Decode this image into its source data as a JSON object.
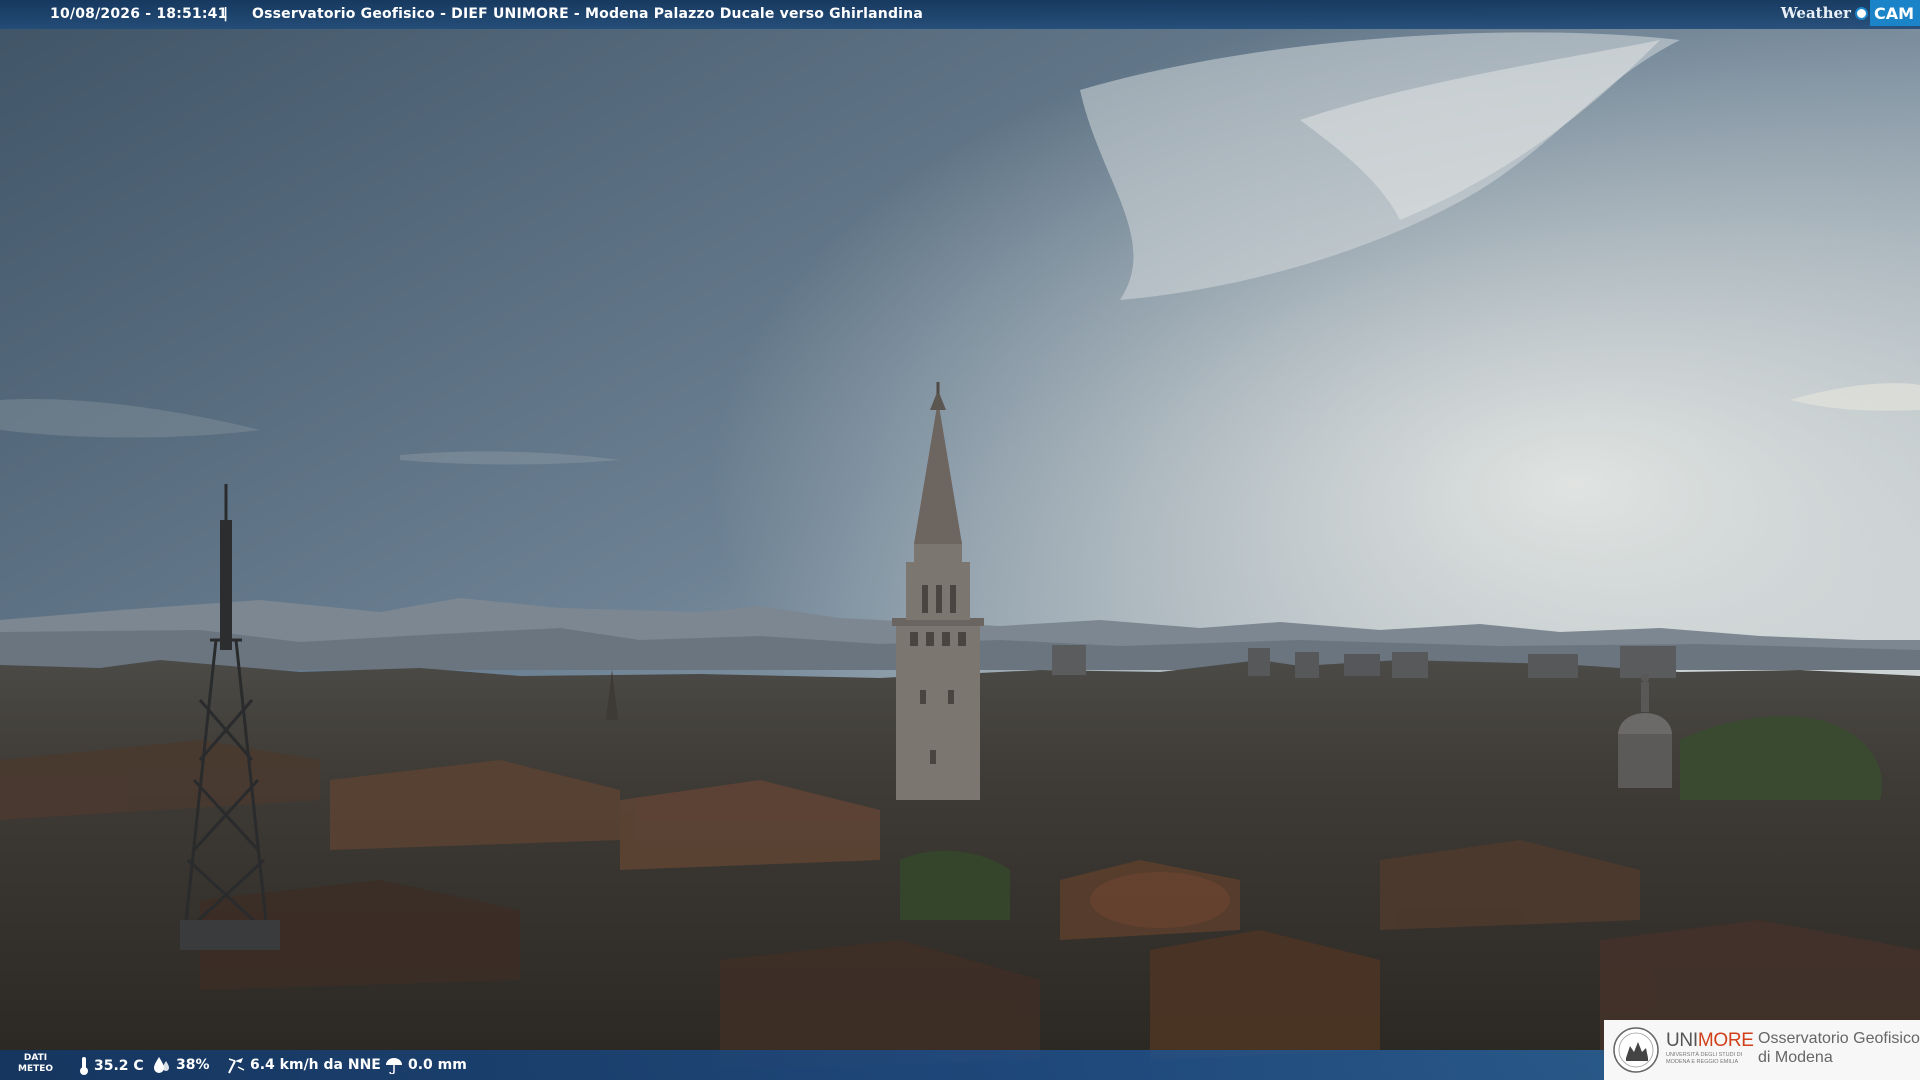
{
  "top_bar": {
    "datetime": "10/08/2026 - 18:51:41",
    "separator": "|",
    "title": "Osservatorio Geofisico - DIEF UNIMORE - Modena Palazzo Ducale verso Ghirlandina",
    "weathercam_word": "Weather",
    "weathercam_cam": "CAM"
  },
  "weather_data": {
    "label_line1": "DATI",
    "label_line2": "METEO",
    "temperature": "35.2 C",
    "humidity": "38%",
    "wind": "6.4 km/h da NNE",
    "rain": "0.0 mm"
  },
  "logo": {
    "unimore_a": "UNI",
    "unimore_b": "MORE",
    "unimore_sub1": "UNIVERSITÀ DEGLI STUDI DI",
    "unimore_sub2": "MODENA E REGGIO EMILIA",
    "observatory_line1": "Osservatorio Geofisico",
    "observatory_line2": "di Modena"
  },
  "colors": {
    "bar_blue": "#1e4b78",
    "cam_blue": "#1b83c8",
    "unimore_red": "#d0411b"
  },
  "icons": [
    "thermometer-icon",
    "humidity-drop-icon",
    "wind-icon",
    "rain-umbrella-icon",
    "weathercam-logo",
    "unimore-seal"
  ]
}
